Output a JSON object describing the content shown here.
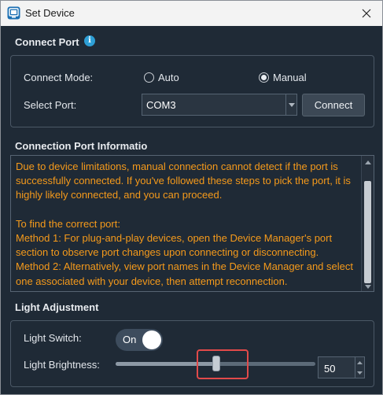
{
  "window": {
    "title": "Set Device"
  },
  "connect_port": {
    "section_title": "Connect Port",
    "mode_label": "Connect Mode:",
    "mode_options": [
      {
        "label": "Auto",
        "checked": false
      },
      {
        "label": "Manual",
        "checked": true
      }
    ],
    "port_label": "Select Port:",
    "port_value": "COM3",
    "connect_button": "Connect"
  },
  "connection_info": {
    "section_title": "Connection Port Informatio",
    "text": "Due to device limitations, manual connection cannot detect if the port is successfully connected. If you've followed these steps to pick the port, it is highly likely connected, and you can proceed.\n\nTo find the correct port:\nMethod 1: For plug-and-play devices, open the Device Manager's port section to observe port changes upon connecting or disconnecting.\nMethod 2: Alternatively, view port names in the Device Manager and select one associated with your device, then attempt reconnection."
  },
  "light_adjustment": {
    "section_title": "Light Adjustment",
    "switch_label": "Light Switch:",
    "switch_state": "On",
    "brightness_label": "Light Brightness:",
    "brightness_value": "50",
    "brightness_fraction": 0.5
  },
  "colors": {
    "background": "#1f2a36",
    "info_text": "#f59a1b",
    "highlight": "#e24a4a"
  }
}
